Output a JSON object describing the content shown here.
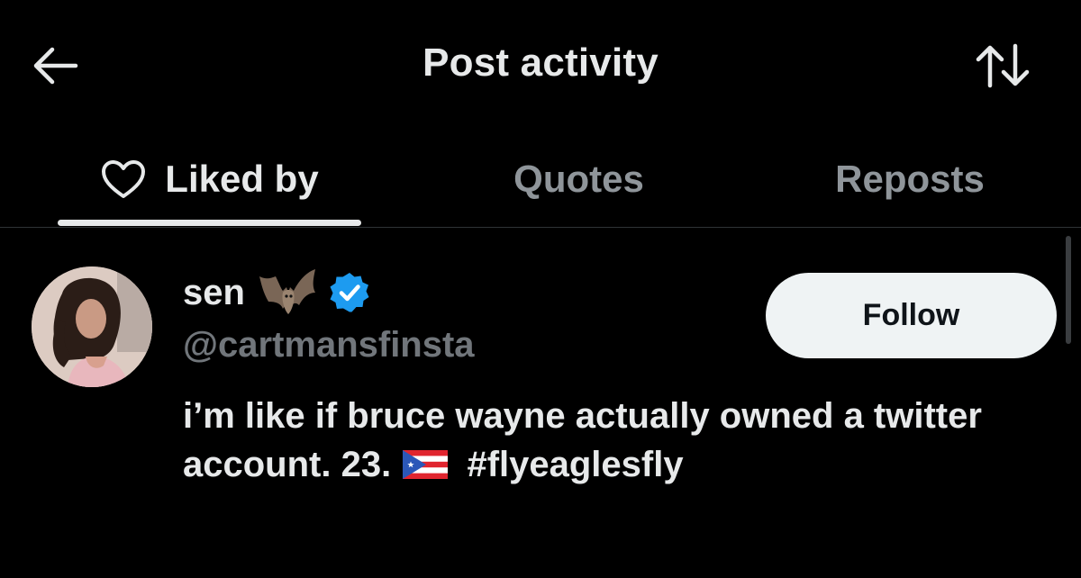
{
  "header": {
    "title": "Post activity",
    "back_icon": "arrow-left-icon",
    "sort_icon": "sort-arrows-icon"
  },
  "tabs": [
    {
      "label": "Liked by",
      "icon": "heart-outline-icon",
      "active": true
    },
    {
      "label": "Quotes",
      "active": false
    },
    {
      "label": "Reposts",
      "active": false
    }
  ],
  "users": [
    {
      "display_name": "sen",
      "name_emoji": "bat-icon",
      "verified": true,
      "handle": "@cartmansfinsta",
      "bio_text": "i’m like if bruce wayne actually owned a twitter account. 23.",
      "bio_flag": "puerto-rico-flag-icon",
      "bio_hashtag": "#flyeaglesfly",
      "follow_label": "Follow"
    }
  ],
  "colors": {
    "background": "#000000",
    "primary_text": "#e7e9ea",
    "secondary_text": "#71767b",
    "inactive_tab": "#8f959a",
    "verified_badge": "#1d9bf0",
    "follow_button_bg": "#eff3f4",
    "divider": "#2f3336"
  }
}
